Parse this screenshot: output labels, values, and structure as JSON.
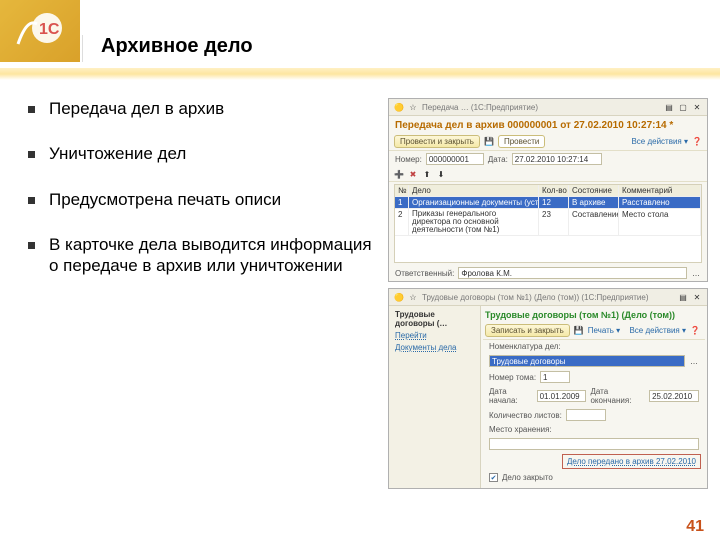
{
  "slide": {
    "title": "Архивное дело",
    "page_number": "41",
    "bullets": [
      "Передача дел в архив",
      "Уничтожение дел",
      "Предусмотрена печать описи",
      "В карточке дела выводится информация о передаче в архив или уничтожении"
    ]
  },
  "win1": {
    "titlebar": "Передача … (1С:Предприятие)",
    "doc_title": "Передача дел в архив 000000001 от 27.02.2010 10:27:14 *",
    "btn_post_close": "Провести и закрыть",
    "btn_post": "Провести",
    "link_all_actions": "Все действия ▾",
    "label_number": "Номер:",
    "value_number": "000000001",
    "label_date": "Дата:",
    "value_date": "27.02.2010 10:27:14",
    "table_headers": [
      "№",
      "Дело",
      "Кол-во",
      "Состояние",
      "Комментарий"
    ],
    "row_selected": {
      "n": "1",
      "name": "Организационные документы (устав …",
      "qty": "12",
      "state": "В архиве",
      "comment": "Расставлено"
    },
    "row2": {
      "n": "2",
      "name": "Приказы генерального директора по основной деятельности (том №1)",
      "qty": "23",
      "state": "Составление",
      "comment": "Место стола"
    },
    "label_responsible": "Ответственный:",
    "value_responsible": "Фролова К.М."
  },
  "win2": {
    "titlebar": "Трудовые договоры (том №1) (Дело (том)) (1С:Предприятие)",
    "sidebar": {
      "primary": "Трудовые договоры (…",
      "items": [
        "Перейти",
        "Документы дела"
      ]
    },
    "doc_title": "Трудовые договоры (том №1) (Дело (том))",
    "btn_save_close": "Записать и закрыть",
    "btn_print": "Печать ▾",
    "link_all_actions": "Все действия ▾",
    "label_nomen": "Номенклатура дел:",
    "value_nomen": "Трудовые договоры",
    "label_tome": "Номер тома:",
    "value_tome": "1",
    "label_open": "Дата начала:",
    "value_open": "01.01.2009",
    "label_close": "Дата окончания:",
    "value_close": "25.02.2010",
    "label_sheets": "Количество листов:",
    "label_place": "Место хранения:",
    "archive_link": "Дело передано в архив 27.02.2010",
    "checkbox_label": "Дело закрыто"
  }
}
